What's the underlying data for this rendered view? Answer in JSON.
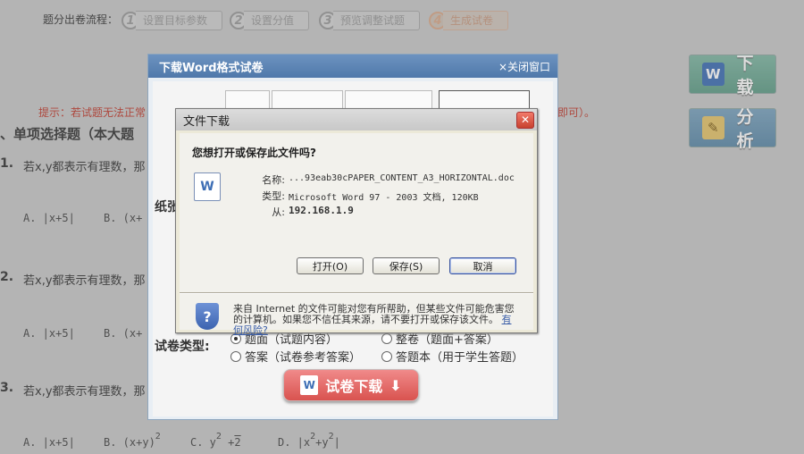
{
  "flow": {
    "label": "题分出卷流程：",
    "steps": [
      {
        "num": "1",
        "label": "设置目标参数"
      },
      {
        "num": "2",
        "label": "设置分值"
      },
      {
        "num": "3",
        "label": "预览调整试题"
      },
      {
        "num": "4",
        "label": "生成试卷"
      }
    ]
  },
  "hint": {
    "text": "提示：若试题无法正常",
    "tail": "即可）。"
  },
  "section_title": "、单项选择题（本大题",
  "questions": [
    {
      "num": "1.",
      "text": "若x,y都表示有理数，那",
      "opts": [
        "A. |x+5|",
        "B. (x+"
      ]
    },
    {
      "num": "2.",
      "text": "若x,y都表示有理数，那",
      "opts": [
        "A. |x+5|",
        "B. (x+"
      ]
    },
    {
      "num": "3.",
      "text": "若x,y都表示有理数，那",
      "opts": [
        "A. |x+5|",
        "B. (x+y)",
        "2",
        "C. y",
        "2",
        "+",
        "2",
        "D. |x",
        "2",
        "+y",
        "2",
        "|"
      ]
    }
  ],
  "side_buttons": {
    "download": "下载",
    "analysis": "分析"
  },
  "word_dialog": {
    "title": "下载Word格式试卷",
    "close": "×关闭窗口",
    "paper_label": "纸张",
    "type_label": "试卷类型:",
    "options": [
      "题面（试题内容）",
      "整卷（题面+答案）",
      "答案（试卷参考答案）",
      "答题本（用于学生答题）"
    ],
    "download_button": "试卷下载"
  },
  "file_dialog": {
    "title": "文件下载",
    "question": "您想打开或保存此文件吗?",
    "name_label": "名称:",
    "name_value": "...93eab30cPAPER_CONTENT_A3_HORIZONTAL.doc",
    "type_label": "类型:",
    "type_value": "Microsoft Word 97 - 2003 文档, 120KB",
    "from_label": "从:",
    "from_value": "192.168.1.9",
    "open_button": "打开(O)",
    "save_button": "保存(S)",
    "cancel_button": "取消",
    "warning": "来自 Internet 的文件可能对您有所帮助，但某些文件可能危害您的计算机。如果您不信任其来源，请不要打开或保存该文件。",
    "risk_link": "有何风险?"
  }
}
